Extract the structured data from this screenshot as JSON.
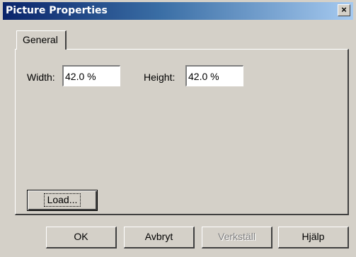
{
  "window": {
    "title": "Picture Properties",
    "close_glyph": "×"
  },
  "tabs": [
    {
      "label": "General",
      "active": true
    }
  ],
  "fields": {
    "width_label": "Width:",
    "width_value": "42.0 %",
    "height_label": "Height:",
    "height_value": "42.0 %"
  },
  "buttons": {
    "load": "Load...",
    "ok": "OK",
    "cancel": "Avbryt",
    "apply": "Verkställ",
    "help": "Hjälp"
  },
  "colors": {
    "face": "#d4d0c8",
    "title_start": "#0a246a",
    "title_end": "#a6caf0"
  }
}
